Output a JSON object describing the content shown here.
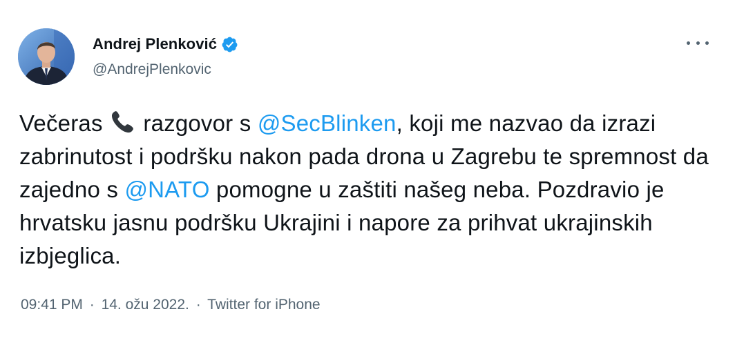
{
  "author": {
    "name": "Andrej Plenković",
    "handle": "@AndrejPlenkovic",
    "verified": true,
    "avatar_icon": "profile-photo"
  },
  "tweet": {
    "segments": [
      {
        "type": "text",
        "value": "Večeras "
      },
      {
        "type": "icon",
        "name": "telephone-receiver-icon"
      },
      {
        "type": "text",
        "value": " razgovor s "
      },
      {
        "type": "mention",
        "value": "@SecBlinken"
      },
      {
        "type": "text",
        "value": ", koji me nazvao da izrazi zabrinutost i podršku nakon pada drona u Zagrebu te spremnost da zajedno s "
      },
      {
        "type": "mention",
        "value": "@NATO"
      },
      {
        "type": "text",
        "value": " pomogne u zaštiti našeg neba. Pozdravio je hrvatsku jasnu podršku Ukrajini i napore za prihvat ukrajinskih izbjeglica."
      }
    ]
  },
  "meta": {
    "time": "09:41 PM",
    "separator": "·",
    "date": "14. ožu 2022.",
    "source": "Twitter for iPhone"
  },
  "colors": {
    "accent": "#1d9bf0",
    "text": "#0f1419",
    "secondary": "#536471"
  }
}
